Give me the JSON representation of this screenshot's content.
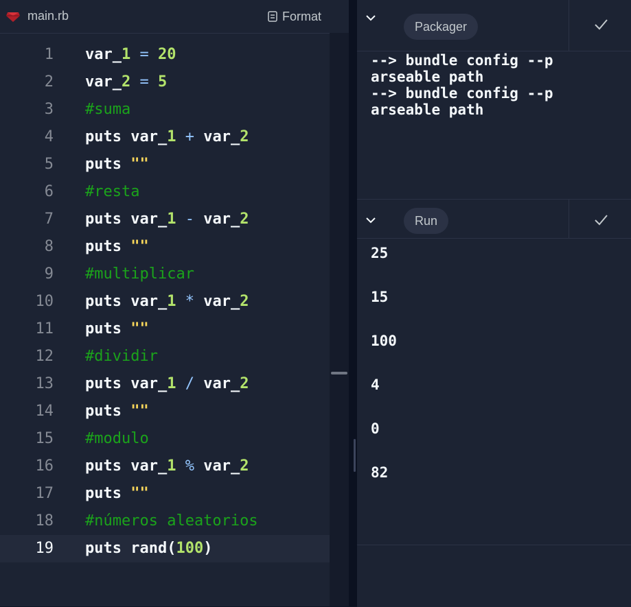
{
  "editor": {
    "file_name": "main.rb",
    "format_label": "Format",
    "lines": [
      {
        "num": "1",
        "code": "var_1 = 20",
        "type": "code"
      },
      {
        "num": "2",
        "code": "var_2 = 5",
        "type": "code"
      },
      {
        "num": "3",
        "code": "#suma",
        "type": "comment"
      },
      {
        "num": "4",
        "code": "puts var_1 + var_2",
        "type": "code"
      },
      {
        "num": "5",
        "code": "puts \"\"",
        "type": "code"
      },
      {
        "num": "6",
        "code": "#resta",
        "type": "comment"
      },
      {
        "num": "7",
        "code": "puts var_1 - var_2",
        "type": "code"
      },
      {
        "num": "8",
        "code": "puts \"\"",
        "type": "code"
      },
      {
        "num": "9",
        "code": "#multiplicar",
        "type": "comment"
      },
      {
        "num": "10",
        "code": "puts var_1 * var_2",
        "type": "code"
      },
      {
        "num": "11",
        "code": "puts \"\"",
        "type": "code"
      },
      {
        "num": "12",
        "code": "#dividir",
        "type": "comment"
      },
      {
        "num": "13",
        "code": "puts var_1 / var_2",
        "type": "code"
      },
      {
        "num": "14",
        "code": "puts \"\"",
        "type": "code"
      },
      {
        "num": "15",
        "code": "#modulo",
        "type": "comment"
      },
      {
        "num": "16",
        "code": "puts var_1 % var_2",
        "type": "code"
      },
      {
        "num": "17",
        "code": "puts \"\"",
        "type": "code"
      },
      {
        "num": "18",
        "code": "#números aleatorios",
        "type": "comment"
      },
      {
        "num": "19",
        "code": "puts rand(100)",
        "type": "code",
        "active": true
      }
    ]
  },
  "packager": {
    "title": "Packager",
    "output": "--> bundle config --p\narseable path\n--> bundle config --p\narseable path"
  },
  "run": {
    "title": "Run",
    "output": [
      "25",
      "15",
      "100",
      "4",
      "0",
      "82"
    ]
  },
  "colors": {
    "comment": "#1ba31b",
    "number": "#b3e36b",
    "string": "#f5d45a",
    "operator": "#93c5fd"
  },
  "icons": {
    "file": "ruby-file-icon",
    "format": "format-icon",
    "collapse": "chevron-down-icon",
    "status": "check-icon"
  }
}
